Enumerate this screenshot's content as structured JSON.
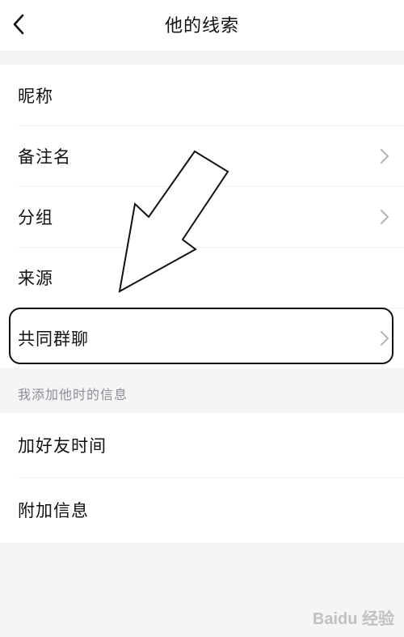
{
  "header": {
    "title": "他的线索",
    "back_icon": "chevron-left-icon"
  },
  "group1": {
    "items": [
      {
        "label": "昵称",
        "has_chevron": false
      },
      {
        "label": "备注名",
        "has_chevron": true
      },
      {
        "label": "分组",
        "has_chevron": true
      },
      {
        "label": "来源",
        "has_chevron": false
      },
      {
        "label": "共同群聊",
        "has_chevron": true,
        "highlighted": true
      }
    ]
  },
  "section2": {
    "caption": "我添加他时的信息",
    "items": [
      {
        "label": "加好友时间"
      },
      {
        "label": "附加信息"
      }
    ]
  },
  "colors": {
    "background": "#f5f5f7",
    "surface": "#ffffff",
    "text": "#111111",
    "caption": "#8e8e93",
    "chevron": "#b5b5ba"
  },
  "watermark": "Baidu 经验"
}
